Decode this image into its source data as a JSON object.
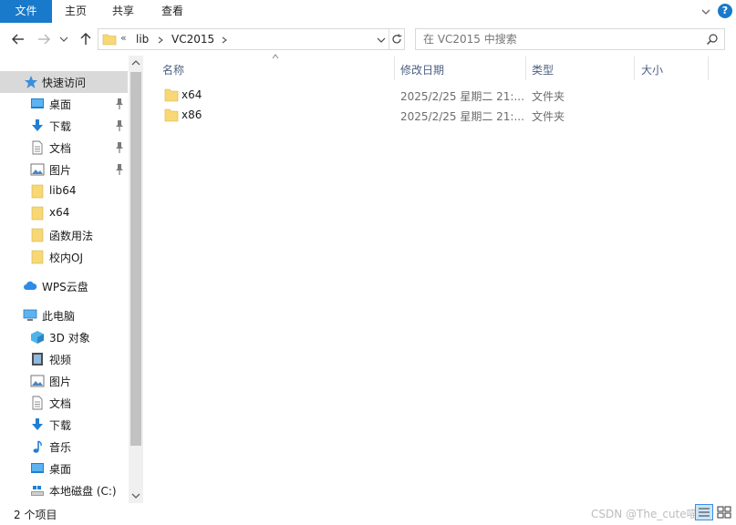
{
  "ribbon": {
    "tabs": [
      "文件",
      "主页",
      "共享",
      "查看"
    ],
    "help": "?"
  },
  "address": {
    "overflow": "«",
    "crumbs": [
      "lib",
      "VC2015"
    ],
    "search_placeholder": "在 VC2015 中搜索"
  },
  "nav": {
    "quick_access": "快速访问",
    "quick_items": [
      {
        "label": "桌面",
        "icon": "desktop-icon",
        "pinned": true
      },
      {
        "label": "下载",
        "icon": "download-icon",
        "pinned": true
      },
      {
        "label": "文档",
        "icon": "document-icon",
        "pinned": true
      },
      {
        "label": "图片",
        "icon": "picture-icon",
        "pinned": true
      },
      {
        "label": "lib64",
        "icon": "folder-icon",
        "pinned": false
      },
      {
        "label": "x64",
        "icon": "folder-icon",
        "pinned": false
      },
      {
        "label": "函数用法",
        "icon": "folder-icon",
        "pinned": false
      },
      {
        "label": "校内OJ",
        "icon": "folder-icon",
        "pinned": false
      }
    ],
    "wps": "WPS云盘",
    "this_pc": "此电脑",
    "pc_items": [
      {
        "label": "3D 对象",
        "icon": "3d-objects-icon"
      },
      {
        "label": "视频",
        "icon": "video-icon"
      },
      {
        "label": "图片",
        "icon": "picture-icon"
      },
      {
        "label": "文档",
        "icon": "document-icon"
      },
      {
        "label": "下载",
        "icon": "download-icon"
      },
      {
        "label": "音乐",
        "icon": "music-icon"
      },
      {
        "label": "桌面",
        "icon": "desktop-icon"
      },
      {
        "label": "本地磁盘 (C:)",
        "icon": "drive-icon"
      }
    ]
  },
  "columns": {
    "name": "名称",
    "date": "修改日期",
    "type": "类型",
    "size": "大小"
  },
  "files": [
    {
      "name": "x64",
      "date": "2025/2/25 星期二 21:...",
      "type": "文件夹"
    },
    {
      "name": "x86",
      "date": "2025/2/25 星期二 21:...",
      "type": "文件夹"
    }
  ],
  "status": {
    "count": "2 个项目",
    "watermark": "CSDN @The_cute喵喵"
  },
  "colors": {
    "accent": "#1979ca",
    "selected": "#d9d9d9",
    "folder": "#f8d775",
    "header_text": "#4d6082"
  }
}
